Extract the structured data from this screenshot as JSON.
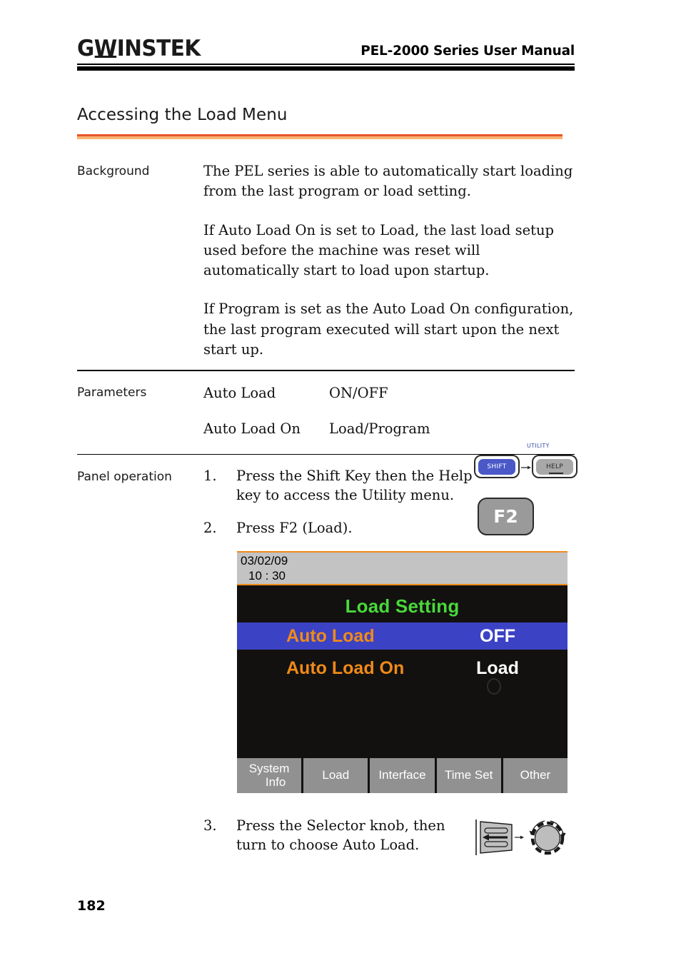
{
  "header": {
    "logo_text_gw": "G",
    "logo_text_w": "W",
    "logo_text_instek": "INSTEK",
    "manual_title": "PEL-2000 Series User Manual"
  },
  "section": {
    "title": "Accessing the Load Menu",
    "rule_color_top": "#e8552a",
    "rule_color_bottom": "#f8b272"
  },
  "background": {
    "label": "Background",
    "paragraphs": [
      "The PEL series is able to automatically start loading from the last program or load setting.",
      "If Auto Load On is set to Load, the last load setup used before the machine was reset will automatically start to load upon startup.",
      "If Program is set as the Auto Load On configuration, the last program executed will start upon the next start up."
    ]
  },
  "parameters": {
    "label": "Parameters",
    "rows": [
      {
        "name": "Auto Load",
        "value": "ON/OFF"
      },
      {
        "name": "Auto Load On",
        "value": "Load/Program"
      }
    ]
  },
  "panel_operation": {
    "label": "Panel operation",
    "steps": [
      {
        "num": "1.",
        "text": "Press the Shift Key then the Help key to access the Utility menu."
      },
      {
        "num": "2.",
        "text": "Press F2 (Load)."
      },
      {
        "num": "3.",
        "text": "Press the Selector knob, then turn to choose Auto Load."
      }
    ]
  },
  "keys": {
    "utility_label": "UTILITY",
    "shift_label": "SHIFT",
    "help_label": "HELP",
    "f2_label": "F2",
    "shift_color": "#4a58c8",
    "help_color": "#a8a8a8",
    "f2_color": "#9a9a9a",
    "utility_text_color": "#3a4ea8"
  },
  "lcd": {
    "date": "03/02/09",
    "time": "10 : 30",
    "heading": "Load Setting",
    "heading_color": "#49d93a",
    "status_bar_color": "#c3c3c3",
    "status_border_color": "#f08a18",
    "screen_bg": "#121110",
    "selected_row_color": "#3b43c4",
    "label_color": "#f08a18",
    "items": [
      {
        "label": "Auto Load",
        "value": "OFF",
        "selected": true
      },
      {
        "label": "Auto Load On",
        "value": "Load",
        "selected": false
      }
    ],
    "softkeys": [
      {
        "line1": "System",
        "line2": "Info"
      },
      {
        "line1": "Load",
        "line2": ""
      },
      {
        "line1": "Interface",
        "line2": ""
      },
      {
        "line1": "Time Set",
        "line2": ""
      },
      {
        "line1": "Other",
        "line2": ""
      }
    ]
  },
  "footer": {
    "page_number": "182"
  }
}
